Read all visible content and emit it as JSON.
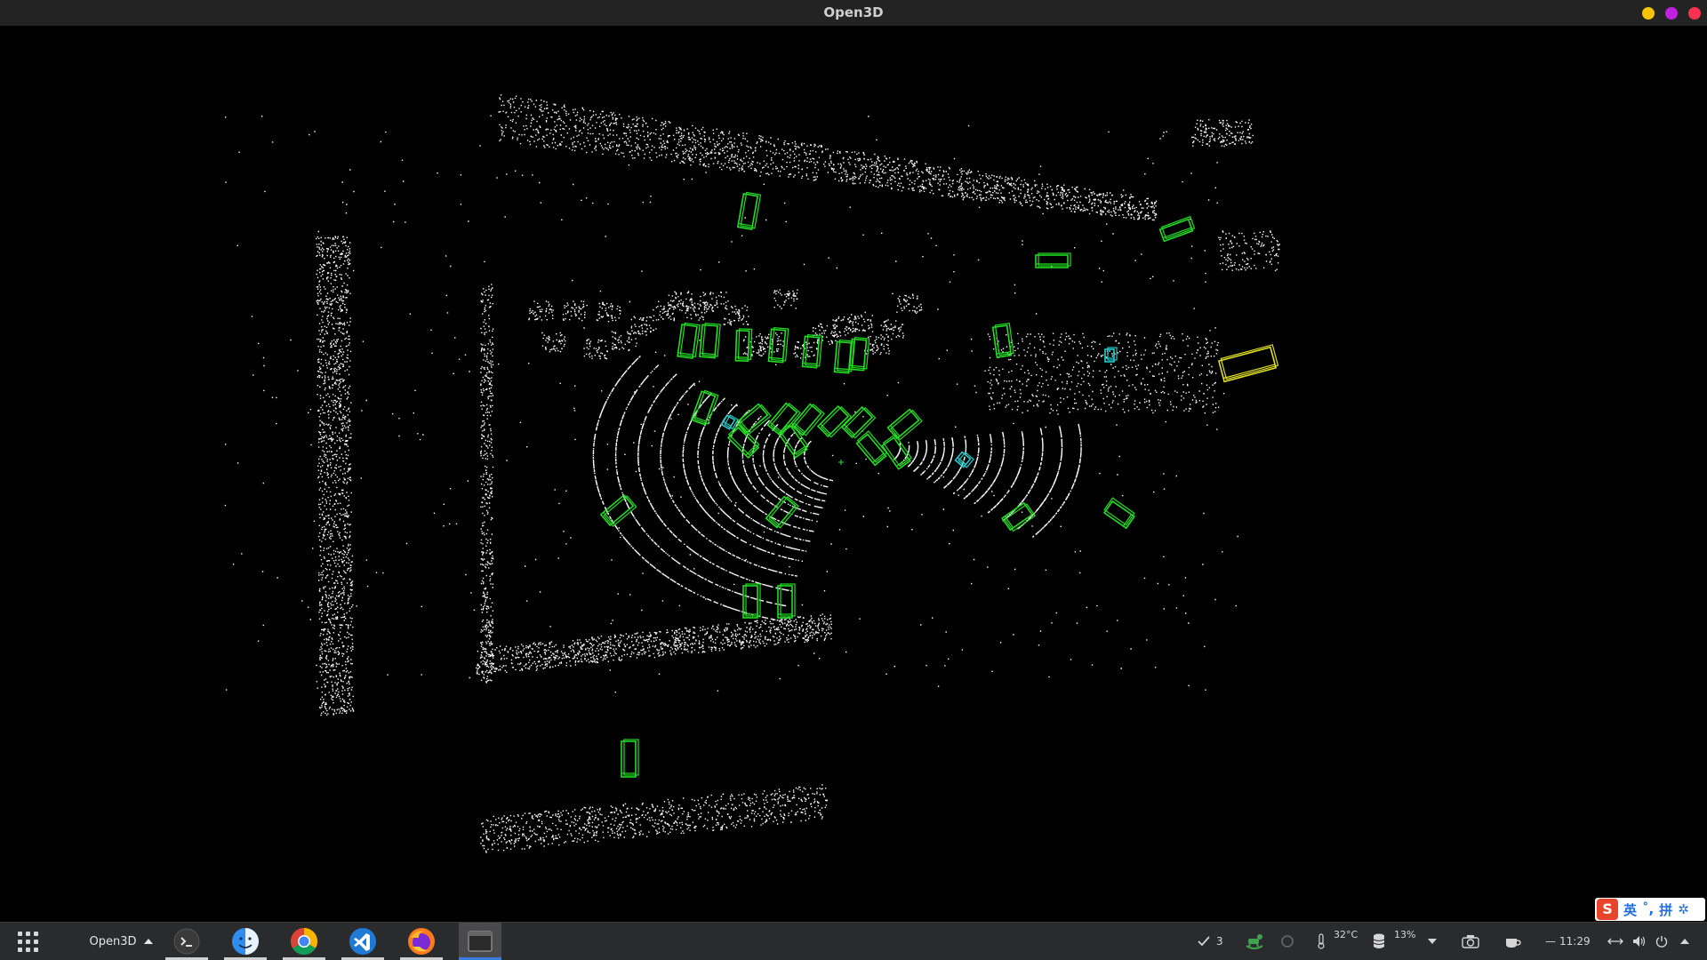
{
  "window": {
    "title": "Open3D",
    "buttons": {
      "minimize_color": "#f5c400",
      "maximize_color": "#c020e0",
      "close_color": "#ff3050"
    }
  },
  "viewport": {
    "background": "#000000",
    "point_color": "#ffffff",
    "box_colors": {
      "car": "#22dd22",
      "pedestrian": "#22cccc",
      "truck": "#dddd22"
    }
  },
  "ime": {
    "logo": "S",
    "mode": "英",
    "punct": "˚,",
    "input": "拼",
    "settings": "✲"
  },
  "taskbar": {
    "active_app": "Open3D",
    "dock": [
      {
        "name": "terminal-icon"
      },
      {
        "name": "finder-icon"
      },
      {
        "name": "chrome-icon"
      },
      {
        "name": "vscode-icon"
      },
      {
        "name": "firefox-icon"
      },
      {
        "name": "open3d-window-icon"
      }
    ],
    "tray": {
      "updates_count": "3",
      "temperature": "32°C",
      "disk_usage": "13%",
      "time_prefix": "—",
      "clock": "11:29"
    }
  }
}
